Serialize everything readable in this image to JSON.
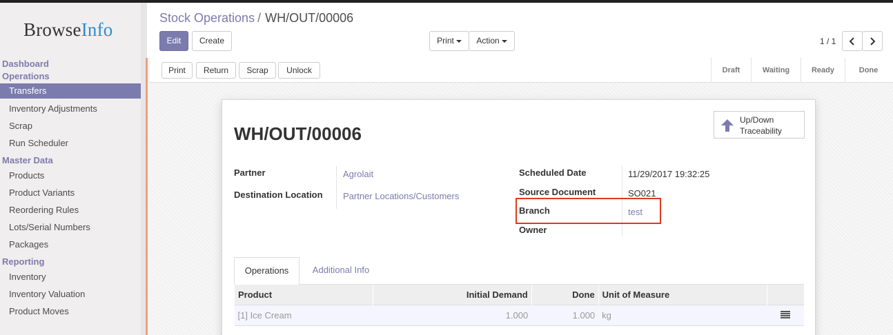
{
  "sidebar": {
    "logo_a": "Browse",
    "logo_b": "Info",
    "sections": [
      {
        "label": "Dashboard"
      },
      {
        "label": "Operations"
      },
      {
        "label": "Master Data"
      },
      {
        "label": "Reporting"
      }
    ],
    "items": [
      {
        "label": "Transfers"
      },
      {
        "label": "Inventory Adjustments"
      },
      {
        "label": "Scrap"
      },
      {
        "label": "Run Scheduler"
      },
      {
        "label": "Products"
      },
      {
        "label": "Product Variants"
      },
      {
        "label": "Reordering Rules"
      },
      {
        "label": "Lots/Serial Numbers"
      },
      {
        "label": "Packages"
      },
      {
        "label": "Inventory"
      },
      {
        "label": "Inventory Valuation"
      },
      {
        "label": "Product Moves"
      }
    ]
  },
  "breadcrumb": {
    "parent": "Stock Operations",
    "separator": "/",
    "current": "WH/OUT/00006"
  },
  "toolbar": {
    "edit": "Edit",
    "create": "Create",
    "print": "Print",
    "action": "Action",
    "pager": "1 / 1"
  },
  "statusbar": {
    "buttons": {
      "print": "Print",
      "return": "Return",
      "scrap": "Scrap",
      "unlock": "Unlock"
    },
    "stages": [
      "Draft",
      "Waiting",
      "Ready",
      "Done"
    ]
  },
  "form": {
    "smart_button": {
      "line1": "Up/Down",
      "line2": "Traceability"
    },
    "title": "WH/OUT/00006",
    "partner_label": "Partner",
    "partner_value": "Agrolait",
    "dest_label": "Destination Location",
    "dest_value": "Partner Locations/Customers",
    "sched_label": "Scheduled Date",
    "sched_value": "11/29/2017 19:32:25",
    "source_label": "Source Document",
    "source_value": "SO021",
    "branch_label": "Branch",
    "branch_value": "test",
    "owner_label": "Owner",
    "owner_value": ""
  },
  "tabs": {
    "operations": "Operations",
    "additional": "Additional Info"
  },
  "table": {
    "headers": {
      "product": "Product",
      "initial_demand": "Initial Demand",
      "done": "Done",
      "uom": "Unit of Measure"
    },
    "rows": [
      {
        "product": "[1] Ice Cream",
        "initial_demand": "1.000",
        "done": "1.000",
        "uom": "kg"
      }
    ]
  },
  "colors": {
    "accent": "#7c7bad",
    "highlight": "#e0391b",
    "left_border": "#f0a07a"
  }
}
